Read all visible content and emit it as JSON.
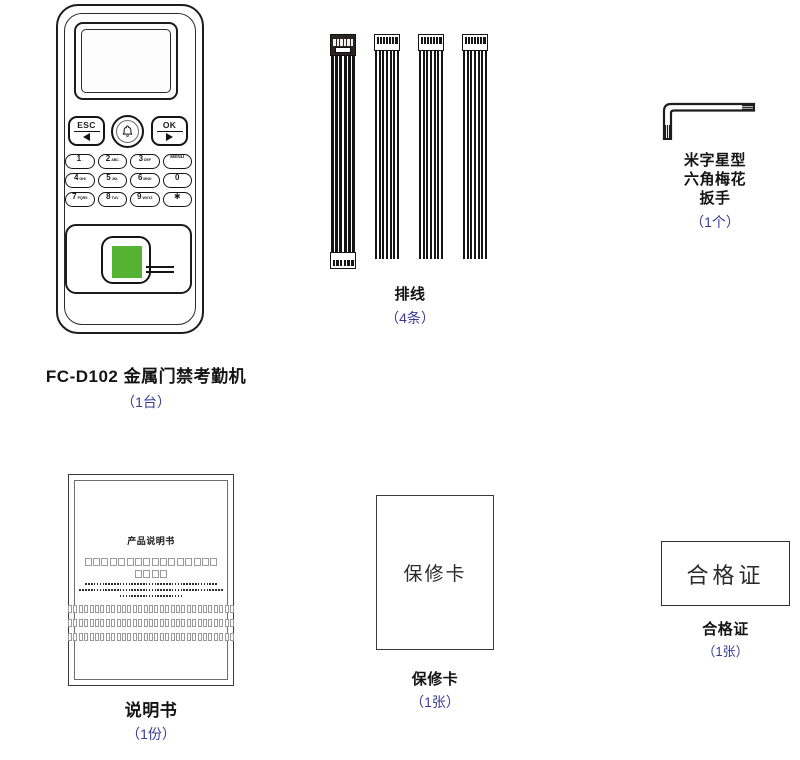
{
  "page": {
    "background": "#ffffff",
    "accent_purple": "#3b3b96",
    "fingerprint_green": "#56b232",
    "line_black": "#141414"
  },
  "items": [
    {
      "id": "device",
      "name": "access-control-terminal",
      "title": "FC-D102 金属门禁考勤机",
      "qty": "（1台）",
      "keys": {
        "esc_label": "ESC",
        "ok_label": "OK",
        "bell_icon": "bell-icon",
        "left_arrow_icon": "arrow-left-icon",
        "right_arrow_icon": "arrow-right-icon",
        "pad": [
          {
            "num": "1",
            "sub": "."
          },
          {
            "num": "2",
            "sub": "ABC"
          },
          {
            "num": "3",
            "sub": "DEF"
          },
          {
            "num": "",
            "sub": "",
            "wide": "MENU"
          },
          {
            "num": "4",
            "sub": "GHI"
          },
          {
            "num": "5",
            "sub": "JKL"
          },
          {
            "num": "6",
            "sub": "MNO"
          },
          {
            "num": "0",
            "sub": ""
          },
          {
            "num": "7",
            "sub": "PQRS"
          },
          {
            "num": "8",
            "sub": "TUV"
          },
          {
            "num": "9",
            "sub": "WXYZ"
          },
          {
            "num": "✱",
            "sub": ""
          }
        ]
      }
    },
    {
      "id": "cables",
      "name": "ribbon-cables",
      "title": "排线",
      "qty": "（4条）",
      "count": 4
    },
    {
      "id": "wrench",
      "name": "hex-star-wrench",
      "title_lines": [
        "米字星型",
        "六角梅花",
        "扳手"
      ],
      "qty": "（1个）"
    },
    {
      "id": "manual",
      "name": "product-manual",
      "doc_title": "产品说明书",
      "title": "说明书",
      "qty": "（1份）",
      "body_rows": [
        16,
        4,
        0,
        0,
        0,
        30,
        30,
        30
      ]
    },
    {
      "id": "warranty",
      "name": "warranty-card",
      "card_text": "保修卡",
      "title": "保修卡",
      "qty": "（1张）"
    },
    {
      "id": "certificate",
      "name": "certificate-of-conformity",
      "card_text": "合格证",
      "title": "合格证",
      "qty": "（1张）"
    }
  ]
}
